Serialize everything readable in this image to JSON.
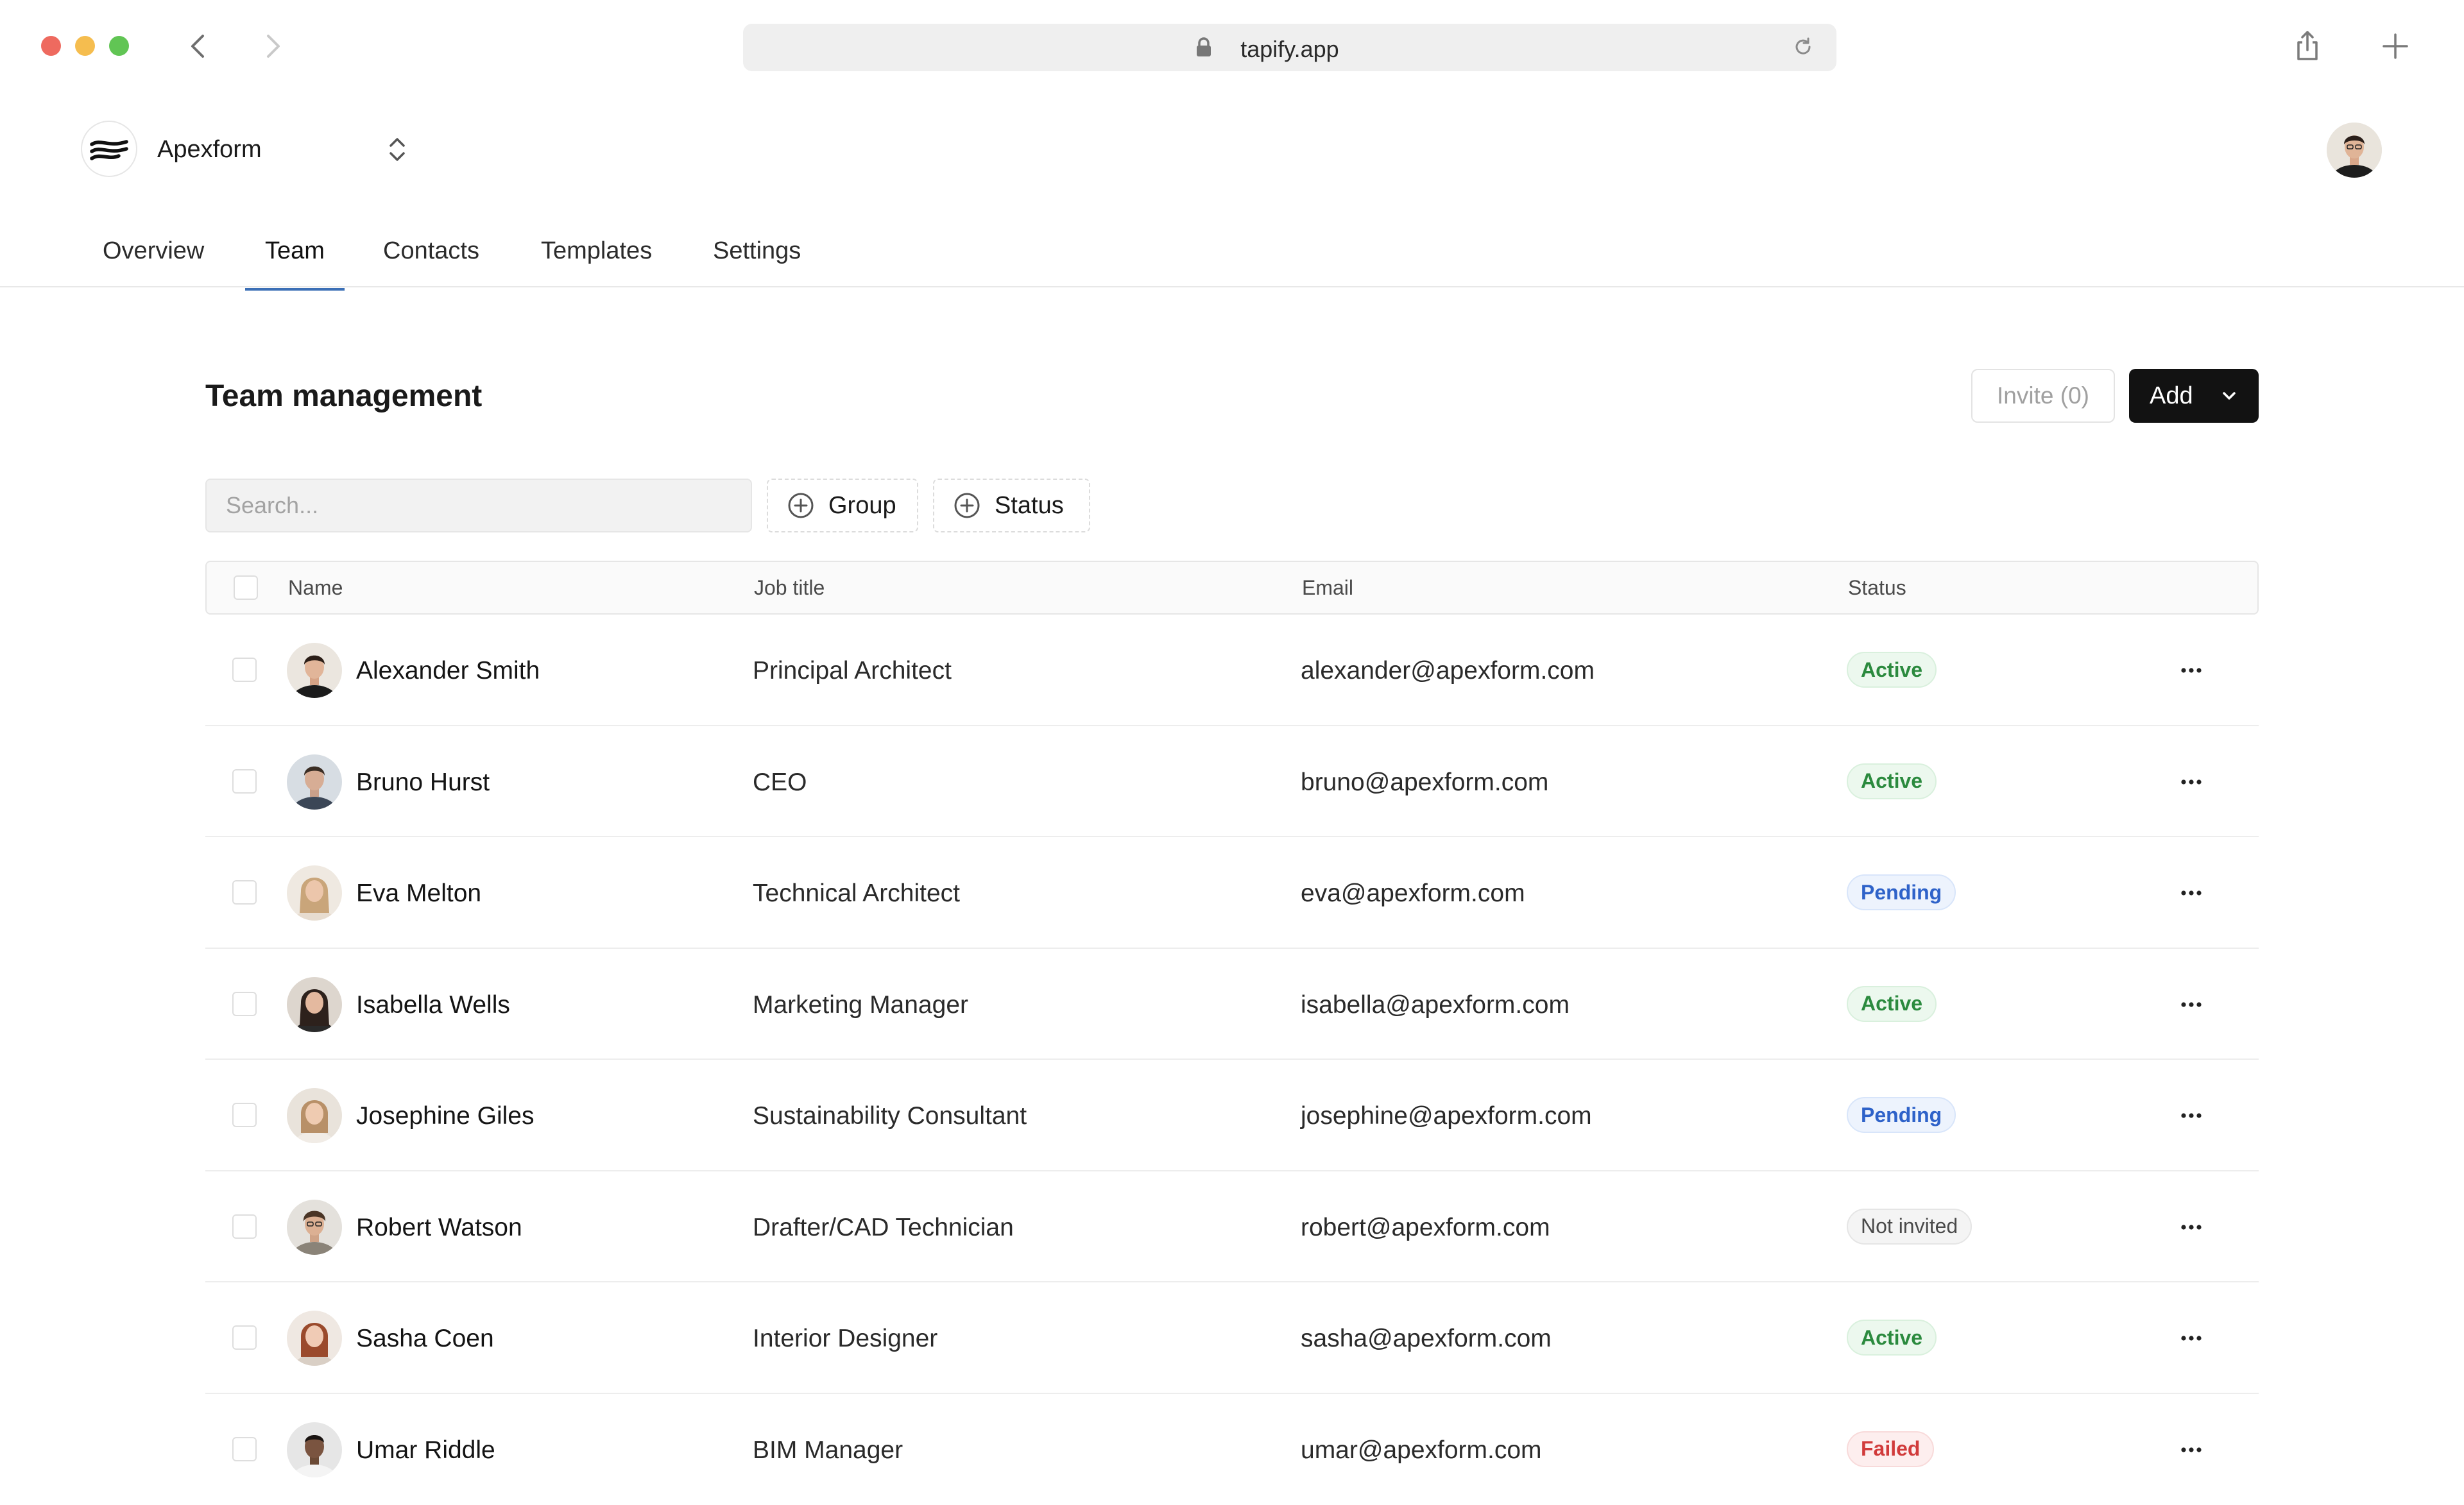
{
  "browser": {
    "url": "tapify.app"
  },
  "app": {
    "workspace_name": "Apexform"
  },
  "tabs": [
    {
      "label": "Overview",
      "active": false
    },
    {
      "label": "Team",
      "active": true
    },
    {
      "label": "Contacts",
      "active": false
    },
    {
      "label": "Templates",
      "active": false
    },
    {
      "label": "Settings",
      "active": false
    }
  ],
  "page": {
    "title": "Team management",
    "invite_label": "Invite (0)",
    "add_label": "Add"
  },
  "filters": {
    "search_placeholder": "Search...",
    "group_label": "Group",
    "status_label": "Status"
  },
  "table": {
    "columns": [
      "Name",
      "Job title",
      "Email",
      "Status"
    ],
    "rows": [
      {
        "name": "Alexander Smith",
        "job": "Principal Architect",
        "email": "alexander@apexform.com",
        "status": "Active",
        "status_kind": "active"
      },
      {
        "name": "Bruno Hurst",
        "job": "CEO",
        "email": "bruno@apexform.com",
        "status": "Active",
        "status_kind": "active"
      },
      {
        "name": "Eva Melton",
        "job": "Technical Architect",
        "email": "eva@apexform.com",
        "status": "Pending",
        "status_kind": "pending"
      },
      {
        "name": "Isabella Wells",
        "job": "Marketing Manager",
        "email": "isabella@apexform.com",
        "status": "Active",
        "status_kind": "active"
      },
      {
        "name": "Josephine Giles",
        "job": "Sustainability Consultant",
        "email": "josephine@apexform.com",
        "status": "Pending",
        "status_kind": "pending"
      },
      {
        "name": "Robert Watson",
        "job": "Drafter/CAD Technician",
        "email": "robert@apexform.com",
        "status": "Not invited",
        "status_kind": "notinvited"
      },
      {
        "name": "Sasha Coen",
        "job": "Interior Designer",
        "email": "sasha@apexform.com",
        "status": "Active",
        "status_kind": "active"
      },
      {
        "name": "Umar Riddle",
        "job": "BIM Manager",
        "email": "umar@apexform.com",
        "status": "Failed",
        "status_kind": "failed"
      }
    ]
  },
  "colors": {
    "accent_tab": "#3b6fb6",
    "primary_button": "#121212",
    "status_active": "#2b8a3e",
    "status_pending": "#2e62c9",
    "status_failed": "#d13b3b"
  }
}
